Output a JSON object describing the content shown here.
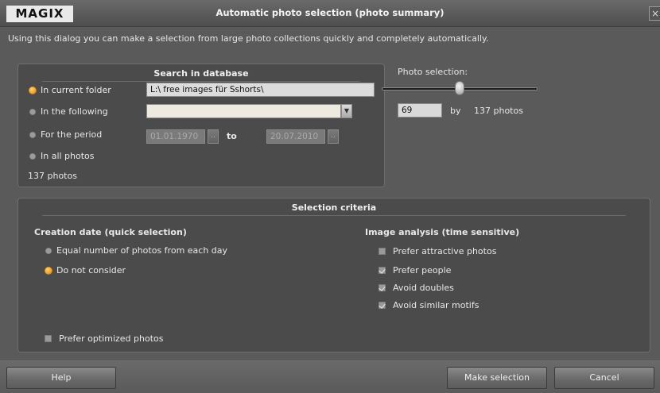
{
  "window": {
    "logo": "MAGIX",
    "title": "Automatic photo selection (photo summary)",
    "close_glyph": "×"
  },
  "intro": "Using this dialog you can make a selection from large photo collections quickly and completely automatically.",
  "search": {
    "heading": "Search in database",
    "options": [
      {
        "label": "In current folder",
        "selected": true
      },
      {
        "label": "In the following",
        "selected": false
      },
      {
        "label": "For the period",
        "selected": false
      },
      {
        "label": "In all photos",
        "selected": false
      }
    ],
    "folder_path": "L:\\  free images für Sshorts\\",
    "following_value": "",
    "period_from": "01.01.1970",
    "period_to_label": "to",
    "period_to": "20.07.2010",
    "date_btn_glyph": "..",
    "combo_glyph": "▼",
    "photo_count": "137 photos"
  },
  "photo_selection": {
    "label": "Photo selection:",
    "value": "69",
    "by_label": "by",
    "total": "137 photos",
    "slider_fraction": 0.5
  },
  "criteria": {
    "heading": "Selection criteria",
    "creation_heading": "Creation date (quick selection)",
    "creation_options": [
      {
        "label": "Equal number of photos from each day",
        "selected": false
      },
      {
        "label": "Do not consider",
        "selected": true
      }
    ],
    "analysis_heading": "Image analysis (time sensitive)",
    "analysis_options": [
      {
        "label": "Prefer attractive photos",
        "checked": false
      },
      {
        "label": "Prefer people",
        "checked": true
      },
      {
        "label": "Avoid doubles",
        "checked": true
      },
      {
        "label": "Avoid similar motifs",
        "checked": true
      }
    ],
    "optimized_label": "Prefer optimized photos",
    "optimized_checked": false
  },
  "buttons": {
    "help": "Help",
    "make_selection": "Make selection",
    "cancel": "Cancel"
  },
  "colors": {
    "background": "#5a5a5a",
    "panel": "#4b4b4b",
    "radio_selected": "#f19b12"
  }
}
